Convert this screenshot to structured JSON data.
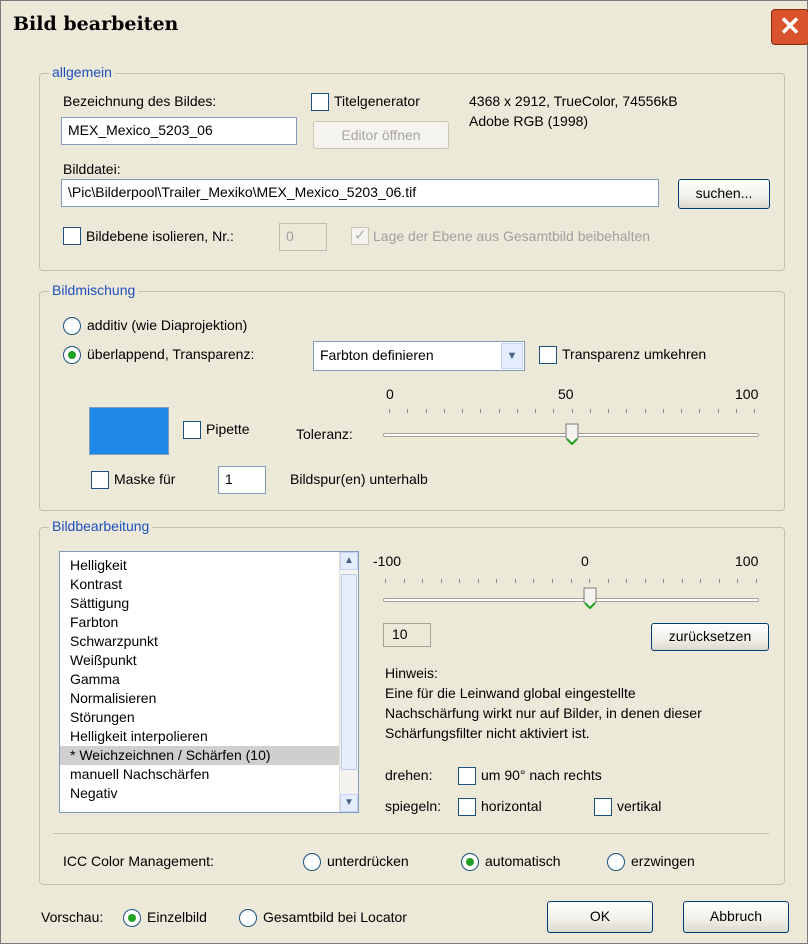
{
  "window": {
    "title": "Bild bearbeiten",
    "close_glyph": "✕"
  },
  "allgemein": {
    "legend": "allgemein",
    "name_label": "Bezeichnung des Bildes:",
    "name_value": "MEX_Mexico_5203_06",
    "title_generator_label": "Titelgenerator",
    "title_generator_checked": false,
    "editor_button": "Editor öffnen",
    "info_line1": "4368 x 2912, TrueColor, 74556kB",
    "info_line2": "Adobe RGB (1998)",
    "file_label": "Bilddatei:",
    "file_value": "\\Pic\\Bilderpool\\Trailer_Mexiko\\MEX_Mexico_5203_06.tif",
    "search_button": "suchen...",
    "isolate_label": "Bildebene isolieren, Nr.:",
    "isolate_checked": false,
    "layer_number": "0",
    "keep_position_label": "Lage der Ebene aus Gesamtbild beibehalten",
    "keep_position_checked": true
  },
  "mixing": {
    "legend": "Bildmischung",
    "additive_label": "additiv (wie Diaprojektion)",
    "overlap_label": "überlappend, Transparenz:",
    "selected_mode": "overlap",
    "transparency_select": "Farbton definieren",
    "invert_label": "Transparenz umkehren",
    "invert_checked": false,
    "swatch_color": "#1e88e8",
    "pipette_label": "Pipette",
    "pipette_checked": false,
    "tolerance_label": "Toleranz:",
    "tolerance_min": "0",
    "tolerance_mid": "50",
    "tolerance_max": "100",
    "tolerance_value": 50,
    "mask_label": "Maske für",
    "mask_checked": false,
    "mask_value": "1",
    "mask_suffix": "Bildspur(en) unterhalb"
  },
  "editing": {
    "legend": "Bildbearbeitung",
    "filters": [
      "Helligkeit",
      "Kontrast",
      "Sättigung",
      "Farbton",
      "Schwarzpunkt",
      "Weißpunkt",
      "Gamma",
      "Normalisieren",
      "Störungen",
      "Helligkeit interpolieren",
      "* Weichzeichnen / Schärfen (10)",
      "manuell Nachschärfen",
      "Negativ"
    ],
    "selected_filter_index": 10,
    "slider_min": "-100",
    "slider_mid": "0",
    "slider_max": "100",
    "slider_value": 10,
    "value_display": "10",
    "reset_button": "zurücksetzen",
    "hint_title": "Hinweis:",
    "hint_line1": "Eine für die Leinwand global eingestellte",
    "hint_line2": "Nachschärfung wirkt nur auf Bilder, in denen dieser",
    "hint_line3": "Schärfungsfilter nicht aktiviert ist.",
    "rotate_label": "drehen:",
    "rotate_option": "um 90° nach rechts",
    "rotate_checked": false,
    "mirror_label": "spiegeln:",
    "mirror_horizontal": "horizontal",
    "mirror_vertical": "vertikal",
    "icc_label": "ICC Color Management:",
    "icc_options": [
      "unterdrücken",
      "automatisch",
      "erzwingen"
    ],
    "icc_selected": "automatisch"
  },
  "footer": {
    "preview_label": "Vorschau:",
    "preview_single": "Einzelbild",
    "preview_total": "Gesamtbild bei Locator",
    "preview_selected": "Einzelbild",
    "ok_button": "OK",
    "cancel_button": "Abbruch"
  }
}
